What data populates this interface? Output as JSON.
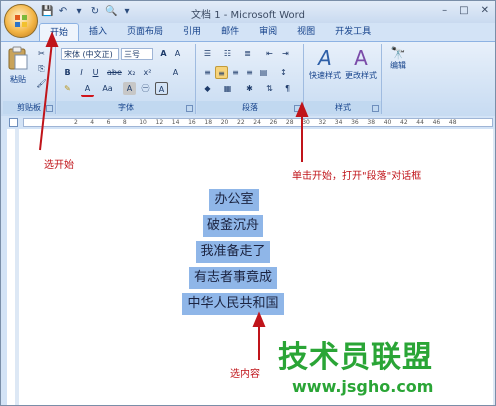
{
  "window": {
    "title": "文档 1 - Microsoft Word",
    "controls": [
      "–",
      "□",
      "✕"
    ]
  },
  "quick_access": [
    "💾",
    "↶",
    "▾",
    "↻",
    "🔍",
    "▾"
  ],
  "tabs": [
    "开始",
    "插入",
    "页面布局",
    "引用",
    "邮件",
    "审阅",
    "视图",
    "开发工具"
  ],
  "ribbon": {
    "clipboard": {
      "label": "剪贴板",
      "paste": "粘贴"
    },
    "font": {
      "label": "字体",
      "font_name": "宋体 (中文正)",
      "font_size": "三号",
      "bold": "B",
      "italic": "I",
      "underline": "U",
      "strike": "abe",
      "sub": "x₂",
      "sup": "x²",
      "grow": "A",
      "shrink": "A",
      "case": "Aa",
      "char_border": "A",
      "clear": "A"
    },
    "paragraph": {
      "label": "段落"
    },
    "styles": {
      "label": "样式",
      "quick_styles": "快速样式",
      "change_styles": "更改样式"
    },
    "editing": {
      "label": "编辑"
    }
  },
  "ruler_ticks": [
    "2",
    "4",
    "6",
    "8",
    "10",
    "12",
    "14",
    "16",
    "18",
    "20",
    "22",
    "24",
    "26",
    "28",
    "30",
    "32",
    "34",
    "36",
    "38",
    "40",
    "42",
    "44",
    "46",
    "48"
  ],
  "document": {
    "lines": [
      "办公室",
      "破釜沉舟",
      "我准备走了",
      "有志者事竟成",
      "中华人民共和国"
    ]
  },
  "annotations": {
    "select_start": "选开始",
    "open_paragraph": "单击开始，打开\"段落\"对话框",
    "select_content": "选内容"
  },
  "watermark": {
    "text": "技术员联盟",
    "url": "www.jsgho.com"
  },
  "colors": {
    "annotation": "#c0141a",
    "watermark": "#2aa536",
    "selection": "#8fb6e8"
  }
}
